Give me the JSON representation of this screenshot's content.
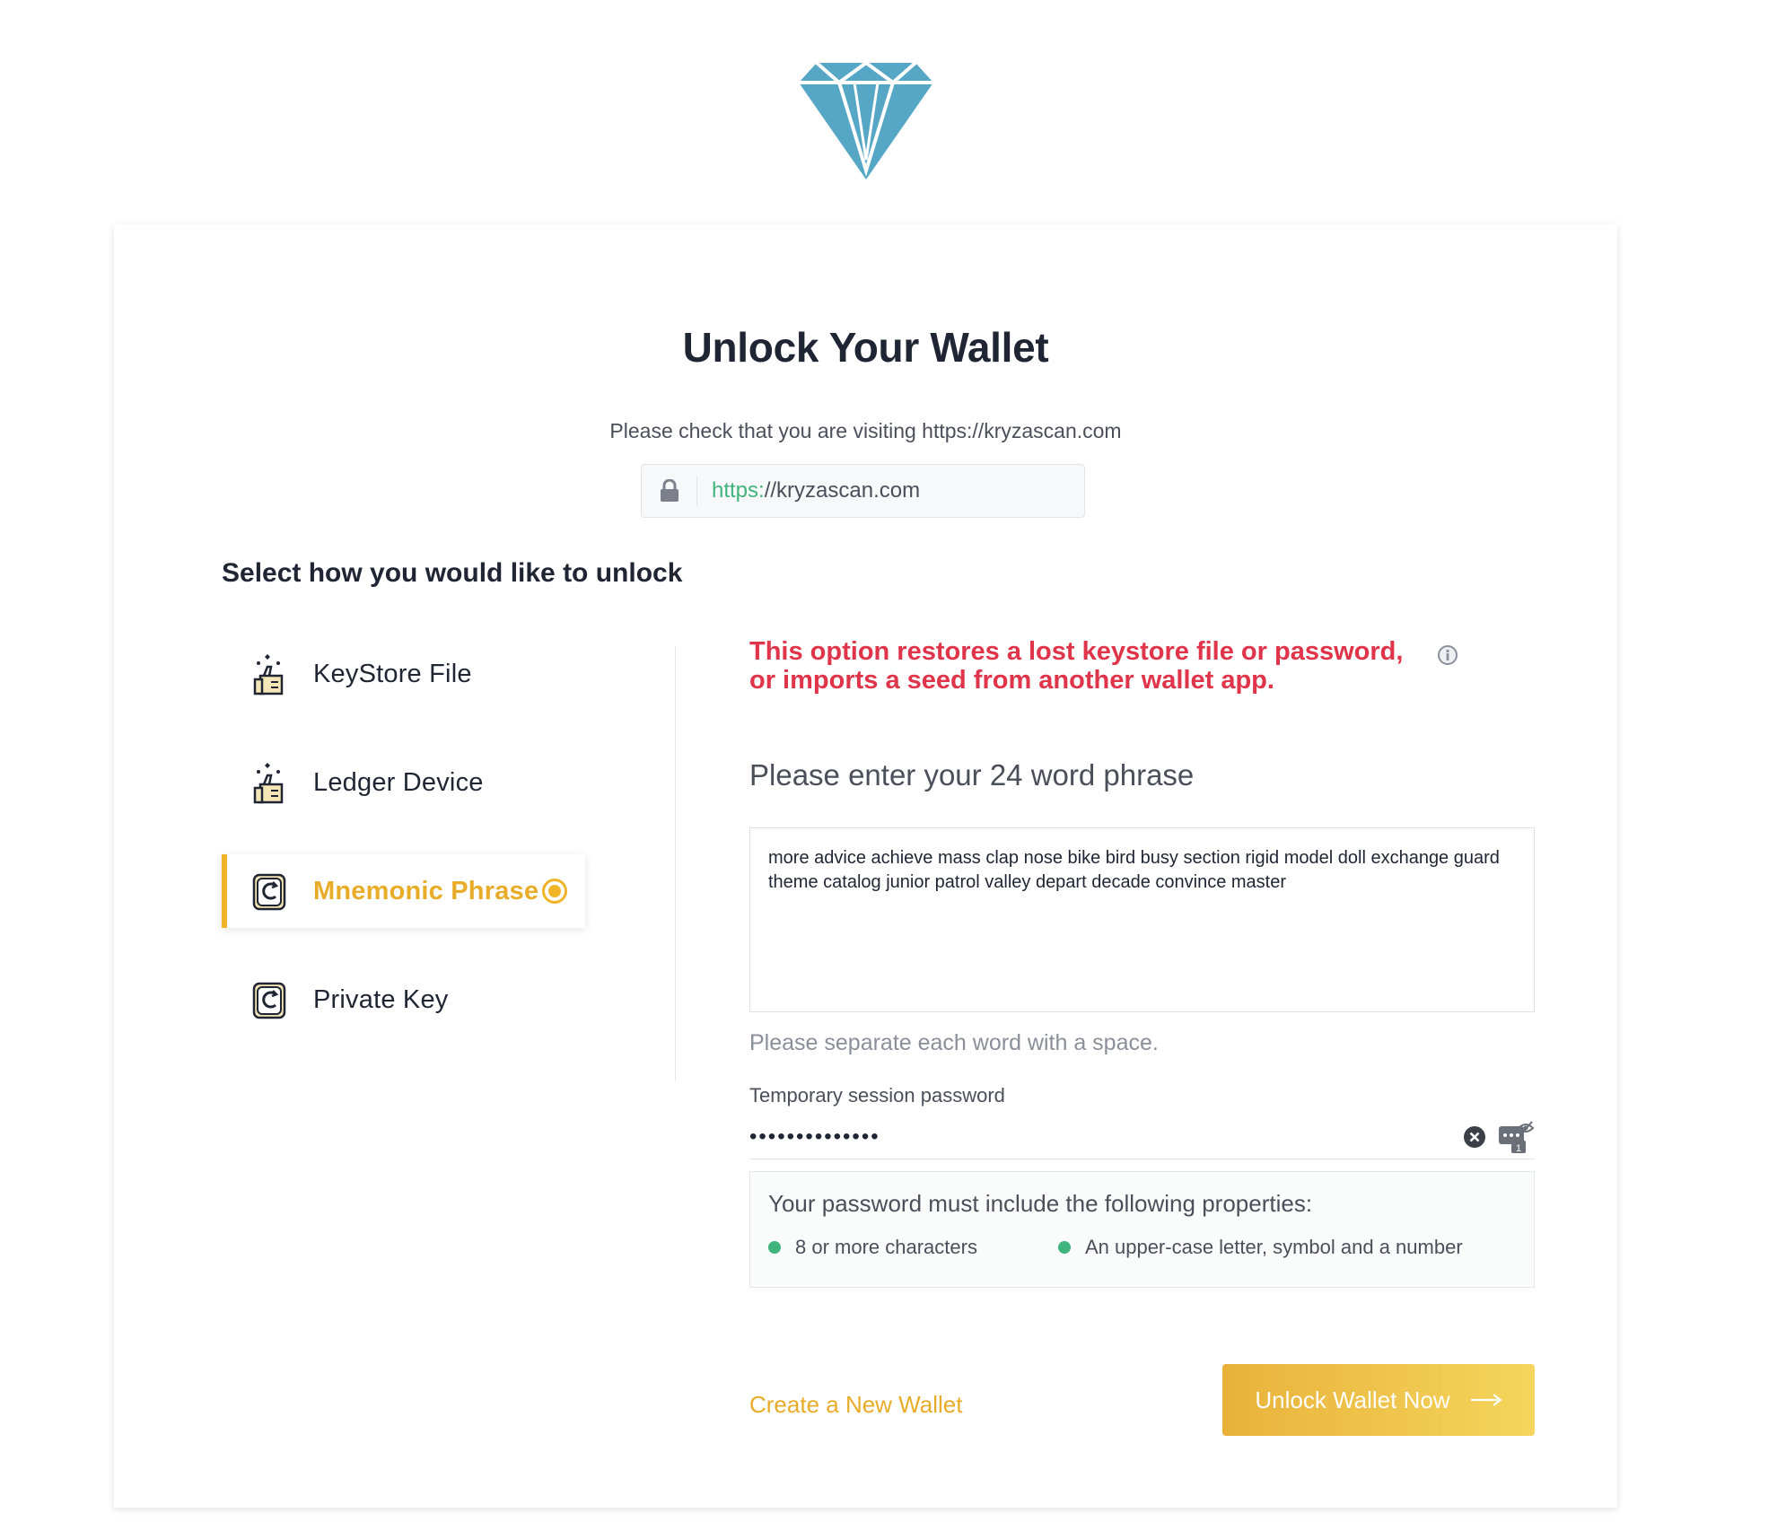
{
  "header": {
    "logo": "diamond-logo"
  },
  "card": {
    "title": "Unlock Your Wallet",
    "visit_note": "Please check that you are visiting https://kryzascan.com",
    "url_scheme": "https:",
    "url_rest": "//kryzascan.com",
    "select_label": "Select how you would like to unlock"
  },
  "options": [
    {
      "label": "KeyStore File",
      "icon": "keystore-icon",
      "active": false
    },
    {
      "label": "Ledger Device",
      "icon": "ledger-icon",
      "active": false
    },
    {
      "label": "Mnemonic Phrase",
      "icon": "mnemonic-icon",
      "active": true
    },
    {
      "label": "Private Key",
      "icon": "private-key-icon",
      "active": false
    }
  ],
  "mnemonic": {
    "warning_line1": "This option restores a lost keystore file or password,",
    "warning_line2": "or imports a seed from another wallet app.",
    "phrase_label": "Please enter your 24 word phrase",
    "phrase_value": "more advice achieve mass clap nose bike bird busy section rigid model doll exchange guard theme catalog junior patrol valley depart decade convince master",
    "phrase_hint": "Please separate each word with a space.",
    "password_label": "Temporary session password",
    "password_value": "••••••••••••••",
    "requirements_title": "Your password must include the following properties:",
    "requirements": [
      "8 or more characters",
      "An upper-case letter, symbol and a number"
    ],
    "create_link": "Create a New Wallet",
    "unlock_button": "Unlock Wallet Now"
  },
  "colors": {
    "accent": "#f0b429",
    "warning": "#e0344a",
    "success": "#3fb47c",
    "logo": "#4fa3c4"
  }
}
